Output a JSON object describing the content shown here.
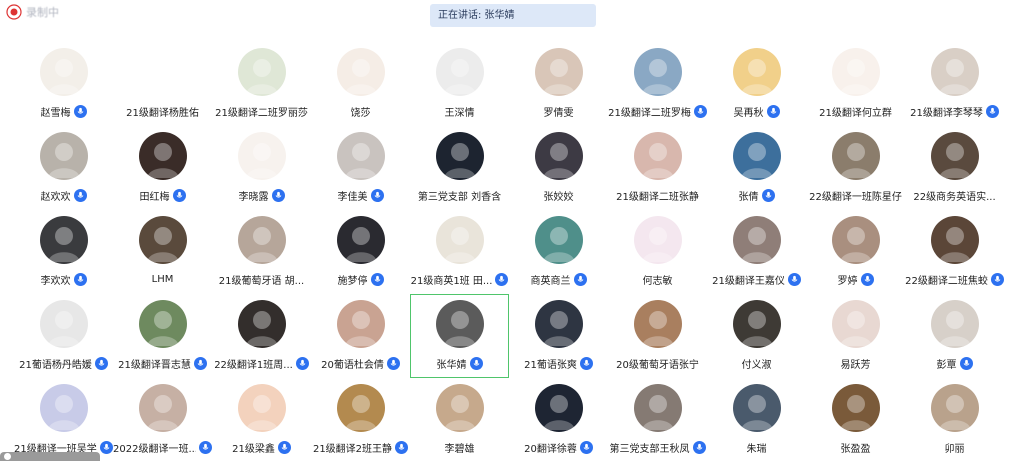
{
  "recording": {
    "label": "录制中",
    "icon": "record-icon"
  },
  "speaking": {
    "text": "正在讲话: 张华婧"
  },
  "highlight_index": 34,
  "colors": {
    "accent": "#2d71f0",
    "highlight": "#4fc56b"
  },
  "participants": [
    {
      "name": "赵雪梅",
      "mic": true,
      "bg": "#f3efe9"
    },
    {
      "name": "21级翻译杨胜佑",
      "mic": false,
      "bg": "#ffffff"
    },
    {
      "name": "21级翻译二班罗丽莎",
      "mic": false,
      "bg": "#dfe7d6"
    },
    {
      "name": "饶莎",
      "mic": false,
      "bg": "#f5ede6"
    },
    {
      "name": "王深情",
      "mic": false,
      "bg": "#ececec"
    },
    {
      "name": "罗倩雯",
      "mic": false,
      "bg": "#d9c6b8"
    },
    {
      "name": "21级翻译二班罗梅",
      "mic": true,
      "bg": "#8aa8c4"
    },
    {
      "name": "吴再秋",
      "mic": true,
      "bg": "#f1d08a"
    },
    {
      "name": "21级翻译何立群",
      "mic": false,
      "bg": "#f8f1ec"
    },
    {
      "name": "21级翻译李琴琴",
      "mic": true,
      "bg": "#d9cfc6"
    },
    {
      "name": "赵欢欢",
      "mic": true,
      "bg": "#b8b2aa"
    },
    {
      "name": "田红梅",
      "mic": true,
      "bg": "#3a2c28"
    },
    {
      "name": "李晓露",
      "mic": true,
      "bg": "#f7f2ee"
    },
    {
      "name": "李佳美",
      "mic": true,
      "bg": "#c9c3bf"
    },
    {
      "name": "第三党支部 刘香含",
      "mic": false,
      "bg": "#1d2430"
    },
    {
      "name": "张姣姣",
      "mic": false,
      "bg": "#3d3a44"
    },
    {
      "name": "21级翻译二班张静",
      "mic": false,
      "bg": "#d8b7ad"
    },
    {
      "name": "张倩",
      "mic": true,
      "bg": "#3d6f9c"
    },
    {
      "name": "22级翻译一班陈星仔",
      "mic": false,
      "bg": "#8b7d6c"
    },
    {
      "name": "22级商务英语实...",
      "mic": false,
      "bg": "#5a4a3e"
    },
    {
      "name": "李欢欢",
      "mic": true,
      "bg": "#3a3b3e"
    },
    {
      "name": "LHM",
      "mic": false,
      "bg": "#5a4a3c"
    },
    {
      "name": "21级葡萄牙语 胡...",
      "mic": false,
      "bg": "#b6a69a"
    },
    {
      "name": "施梦停",
      "mic": true,
      "bg": "#2a2a30"
    },
    {
      "name": "21级商英1班 田...",
      "mic": true,
      "bg": "#e9e4da"
    },
    {
      "name": "商英商兰",
      "mic": true,
      "bg": "#4f8f8a"
    },
    {
      "name": "何志敏",
      "mic": false,
      "bg": "#f4e7ef"
    },
    {
      "name": "21级翻译王嘉仪",
      "mic": true,
      "bg": "#8f7e78"
    },
    {
      "name": "罗婷",
      "mic": true,
      "bg": "#a98f7f"
    },
    {
      "name": "22级翻译二班焦蛟",
      "mic": true,
      "bg": "#5b4638"
    },
    {
      "name": "21葡语杨丹皓媛",
      "mic": true,
      "bg": "#e7e7e7"
    },
    {
      "name": "21级翻译晋志慧",
      "mic": true,
      "bg": "#6e8a5f"
    },
    {
      "name": "22级翻译1班周...",
      "mic": true,
      "bg": "#332e2c"
    },
    {
      "name": "20葡语杜会倩",
      "mic": true,
      "bg": "#c9a392"
    },
    {
      "name": "张华婧",
      "mic": true,
      "bg": "#5b5b5b"
    },
    {
      "name": "21葡语张爽",
      "mic": true,
      "bg": "#2e3542"
    },
    {
      "name": "20级葡萄牙语张宁",
      "mic": false,
      "bg": "#a97f5f"
    },
    {
      "name": "付义淑",
      "mic": false,
      "bg": "#3e3a35"
    },
    {
      "name": "易跃芳",
      "mic": false,
      "bg": "#e8d8d2"
    },
    {
      "name": "彭覃",
      "mic": true,
      "bg": "#d7d0c9"
    },
    {
      "name": "21级翻译一班吴学兰",
      "mic": true,
      "bg": "#c8cbe8"
    },
    {
      "name": "2022级翻译一班...",
      "mic": true,
      "bg": "#c6b0a4"
    },
    {
      "name": "21级梁鑫",
      "mic": true,
      "bg": "#f3d2bd"
    },
    {
      "name": "21级翻译2班王静",
      "mic": true,
      "bg": "#b38a4f"
    },
    {
      "name": "李碧雄",
      "mic": false,
      "bg": "#c6a98c"
    },
    {
      "name": "20翻译徐蓉",
      "mic": true,
      "bg": "#1e2533"
    },
    {
      "name": "第三党支部王秋凤",
      "mic": true,
      "bg": "#857a73"
    },
    {
      "name": "朱瑞",
      "mic": false,
      "bg": "#4a5a6c"
    },
    {
      "name": "张盈盈",
      "mic": false,
      "bg": "#7a5a3a"
    },
    {
      "name": "卯丽",
      "mic": false,
      "bg": "#b9a28c"
    }
  ]
}
